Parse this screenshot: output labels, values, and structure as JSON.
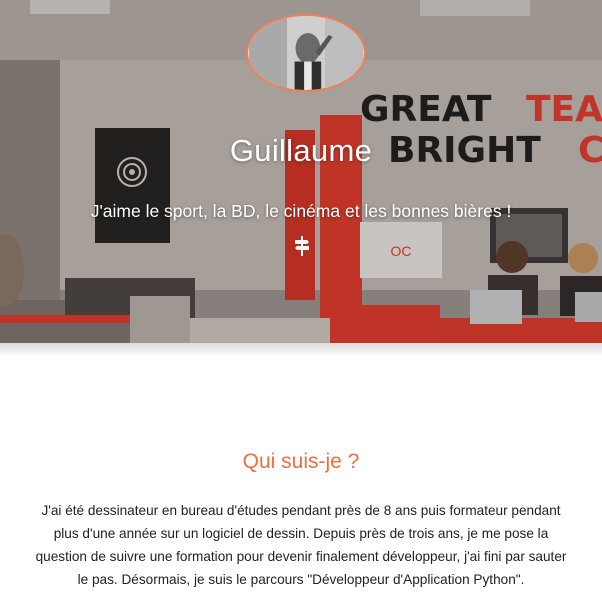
{
  "hero": {
    "background_label": "office-photo",
    "wall_text_line1": "GREAT",
    "wall_text_line2": "BRIGHT",
    "wall_text_partial1": "TEA",
    "wall_text_partial2": "C",
    "name": "Guillaume",
    "tagline": "J'aime le sport, la BD, le cinéma et les bonnes bières !",
    "scroll_icon": "signpost-icon"
  },
  "about": {
    "title": "Qui suis-je ?",
    "text": "J'ai été dessinateur en bureau d'études pendant près de 8 ans puis formateur pendant plus d'une année sur un logiciel de dessin. Depuis près de trois ans, je me pose la question de suivre une formation pour devenir finalement développeur, j'ai fini par sauter le pas. Désormais, je suis le parcours \"Développeur d'Application Python\"."
  },
  "colors": {
    "accent": "#ee6e3e",
    "avatar_border": "#f37f55",
    "wall_red": "#e63a2c",
    "text": "#222222"
  }
}
